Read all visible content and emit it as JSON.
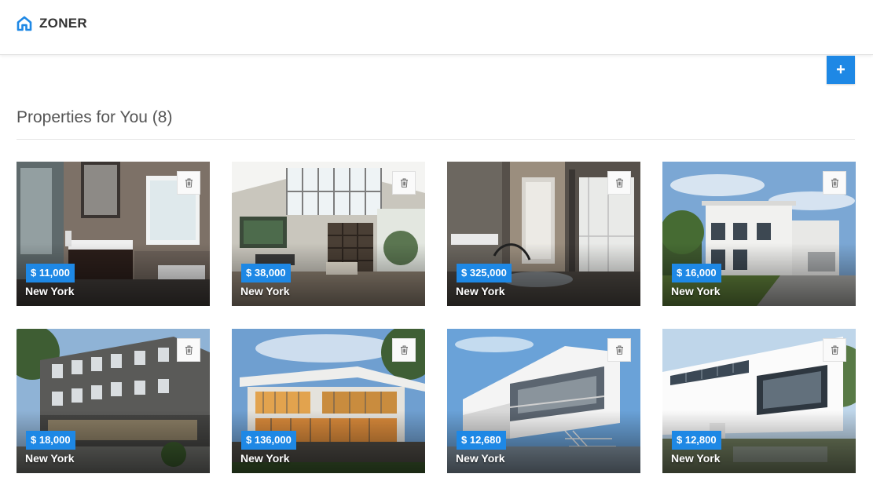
{
  "app": {
    "brand": "ZONER",
    "brand_color": "#1e88e5"
  },
  "toolbar": {
    "add_label": "+"
  },
  "page": {
    "title": "Properties for You (8)"
  },
  "properties": [
    {
      "price": "$ 11,000",
      "city": "New York",
      "scene": "bathroom-interior"
    },
    {
      "price": "$ 38,000",
      "city": "New York",
      "scene": "loft-interior"
    },
    {
      "price": "$ 325,000",
      "city": "New York",
      "scene": "bathroom-interior-dark"
    },
    {
      "price": "$ 16,000",
      "city": "New York",
      "scene": "villa-exterior"
    },
    {
      "price": "$ 18,000",
      "city": "New York",
      "scene": "apartment-block-exterior"
    },
    {
      "price": "$ 136,000",
      "city": "New York",
      "scene": "modern-house-dusk"
    },
    {
      "price": "$ 12,680",
      "city": "New York",
      "scene": "white-modern-house"
    },
    {
      "price": "$ 12,800",
      "city": "New York",
      "scene": "cantilever-house"
    }
  ]
}
